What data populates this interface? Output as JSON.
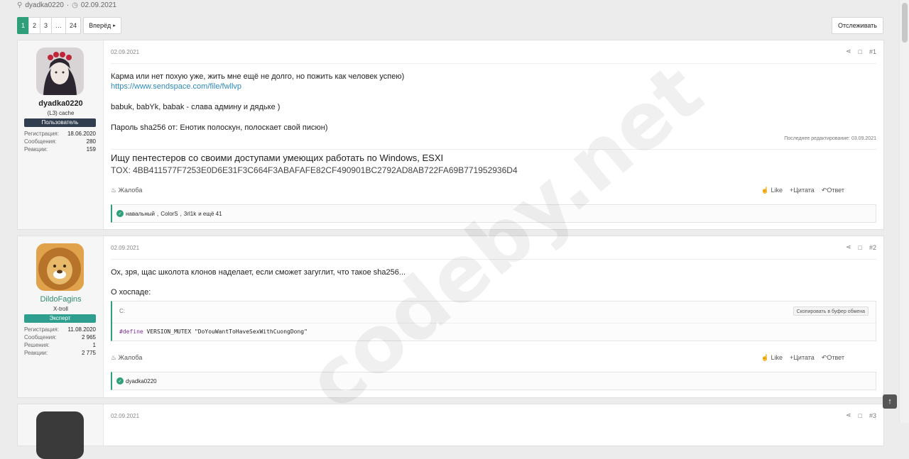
{
  "top": {
    "author": "dyadka0220",
    "separator": "·",
    "date": "02.09.2021"
  },
  "pagination": {
    "pages": [
      "1",
      "2",
      "3",
      "…",
      "24"
    ],
    "active": "1",
    "next_label": "Вперёд"
  },
  "follow_label": "Отслеживать",
  "posts": [
    {
      "date": "02.09.2021",
      "number": "#1",
      "user": {
        "name": "dyadka0220",
        "title": "(L3) cache",
        "badge": "Пользователь",
        "badge_color": "#2f3d4f",
        "name_color": "#1f1f1f",
        "stats": [
          {
            "label": "Регистрация:",
            "value": "18.06.2020"
          },
          {
            "label": "Сообщения:",
            "value": "280"
          },
          {
            "label": "Реакции:",
            "value": "159"
          }
        ]
      },
      "lines": [
        "Карма или нет похую уже, жить мне ещё не долго, но пожить как человек успею)",
        "https://www.sendspace.com/file/fwllvp",
        "babuk, babYk, babak - слава админу и дядьке )",
        "Пароль sha256 от: Енотик полоскун, полоскает свой писюн)"
      ],
      "last_edit": "Последнее редактирование: 03.09.2021",
      "signature": [
        "Ищу пентестеров со своими доступами умеющих работать по Windows, ESXI",
        "TOX: 4BB411577F7253E0D6E31F3C664F3ABAFAFE82CF490901BC2792AD8AB722FA69B771952936D4"
      ],
      "report": "Жалоба",
      "like": "Like",
      "quote": "Цитата",
      "reply": "Ответ",
      "reactions": {
        "users": [
          "навальный",
          "ColorS",
          "3rl1k"
        ],
        "more": "и ещё 41"
      }
    },
    {
      "date": "02.09.2021",
      "number": "#2",
      "user": {
        "name": "DildoFagins",
        "title": "X-troll",
        "badge": "Эксперт",
        "badge_color": "#2e9f8f",
        "name_color": "#2e8a72",
        "stats": [
          {
            "label": "Регистрация:",
            "value": "11.08.2020"
          },
          {
            "label": "Сообщения:",
            "value": "2 965"
          },
          {
            "label": "Решения:",
            "value": "1"
          },
          {
            "label": "Реакции:",
            "value": "2 775"
          }
        ]
      },
      "lines": [
        "Ох, зря, щас школота клонов наделает, если сможет загуглит, что такое sha256...",
        "О хоспаде:"
      ],
      "code": {
        "lang": "C:",
        "copy": "Скопировать в буфер обмена",
        "keyword": "#define",
        "rest": " VERSION_MUTEX \"DoYouWantToHaveSexWithCuongDong\""
      },
      "report": "Жалоба",
      "like": "Like",
      "quote": "Цитата",
      "reply": "Ответ",
      "reactions": {
        "users": [
          "dyadka0220"
        ],
        "more": ""
      }
    },
    {
      "date": "02.09.2021",
      "number": "#3"
    }
  ],
  "watermark": "codeby.net"
}
